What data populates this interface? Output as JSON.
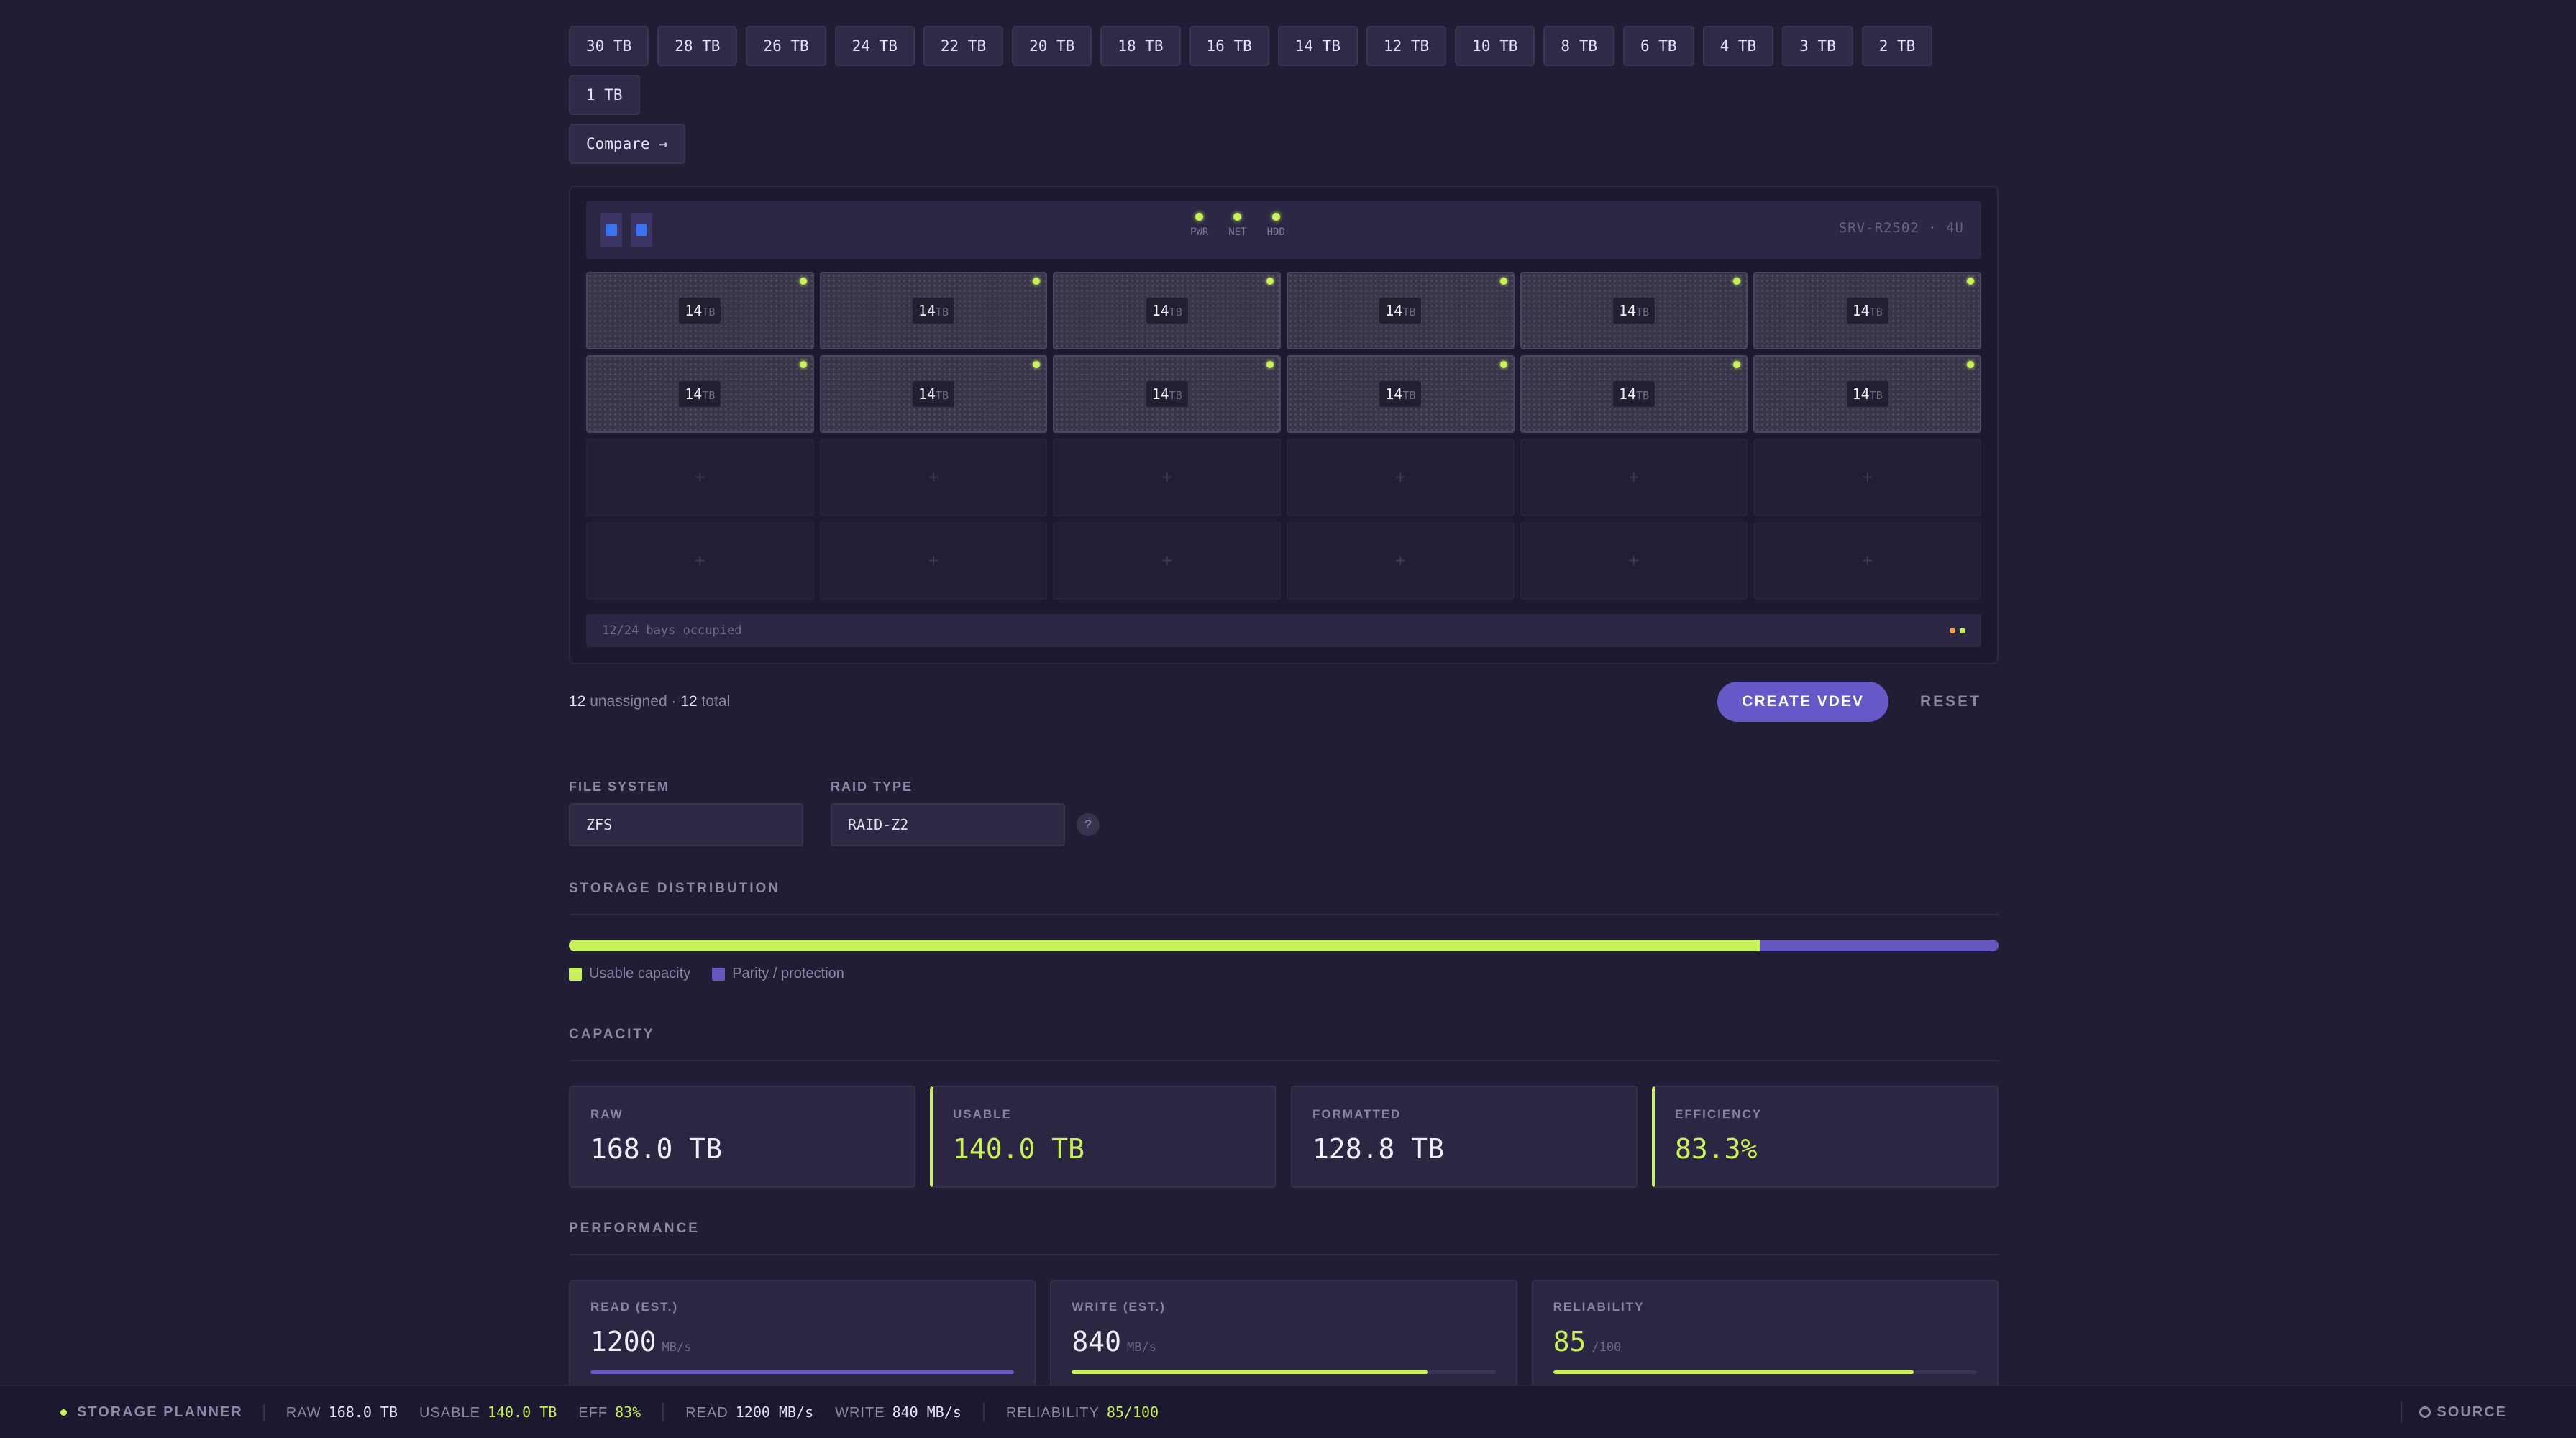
{
  "sizes": [
    "30 TB",
    "28 TB",
    "26 TB",
    "24 TB",
    "22 TB",
    "20 TB",
    "18 TB",
    "16 TB",
    "14 TB",
    "12 TB",
    "10 TB",
    "8 TB",
    "6 TB",
    "4 TB",
    "3 TB",
    "2 TB",
    "1 TB"
  ],
  "compare_label": "Compare →",
  "chassis": {
    "leds": [
      "PWR",
      "NET",
      "HDD"
    ],
    "model": "SRV-R2502 · 4U",
    "drive_num": "14",
    "drive_unit": "TB",
    "empty_symbol": "+",
    "occupancy": "12/24 bays occupied",
    "filled_bays": 12,
    "total_bays": 24
  },
  "assignment": {
    "unassigned_count": "12",
    "unassigned_label": "unassigned",
    "separator": "·",
    "total_count": "12",
    "total_label": "total",
    "create_label": "CREATE VDEV",
    "reset_label": "RESET"
  },
  "fields": {
    "fs_label": "FILE SYSTEM",
    "fs_value": "ZFS",
    "raid_label": "RAID TYPE",
    "raid_value": "RAID-Z2",
    "help": "?"
  },
  "distribution": {
    "title": "STORAGE DISTRIBUTION",
    "usable_fraction": 0.833,
    "usable_label": "Usable capacity",
    "parity_label": "Parity / protection",
    "usable_color": "#c8f05a",
    "parity_color": "#6458be"
  },
  "capacity": {
    "title": "CAPACITY",
    "cards": [
      {
        "label": "RAW",
        "value": "168.0 TB"
      },
      {
        "label": "USABLE",
        "value": "140.0 TB"
      },
      {
        "label": "FORMATTED",
        "value": "128.8 TB"
      },
      {
        "label": "EFFICIENCY",
        "value": "83.3%"
      }
    ]
  },
  "performance": {
    "title": "PERFORMANCE",
    "read": {
      "label": "READ (EST.)",
      "value": "1200",
      "unit": "MB/s",
      "fraction": 1.0
    },
    "write": {
      "label": "WRITE (EST.)",
      "value": "840",
      "unit": "MB/s",
      "fraction": 0.84
    },
    "reliability": {
      "label": "RELIABILITY",
      "value": "85",
      "unit": "/100",
      "fraction": 0.85
    }
  },
  "status": {
    "brand": "STORAGE PLANNER",
    "raw_k": "RAW",
    "raw_v": "168.0 TB",
    "usable_k": "USABLE",
    "usable_v": "140.0 TB",
    "eff_k": "EFF",
    "eff_v": "83%",
    "read_k": "READ",
    "read_v": "1200 MB/s",
    "write_k": "WRITE",
    "write_v": "840 MB/s",
    "rel_k": "RELIABILITY",
    "rel_v": "85/100",
    "source": "SOURCE"
  }
}
